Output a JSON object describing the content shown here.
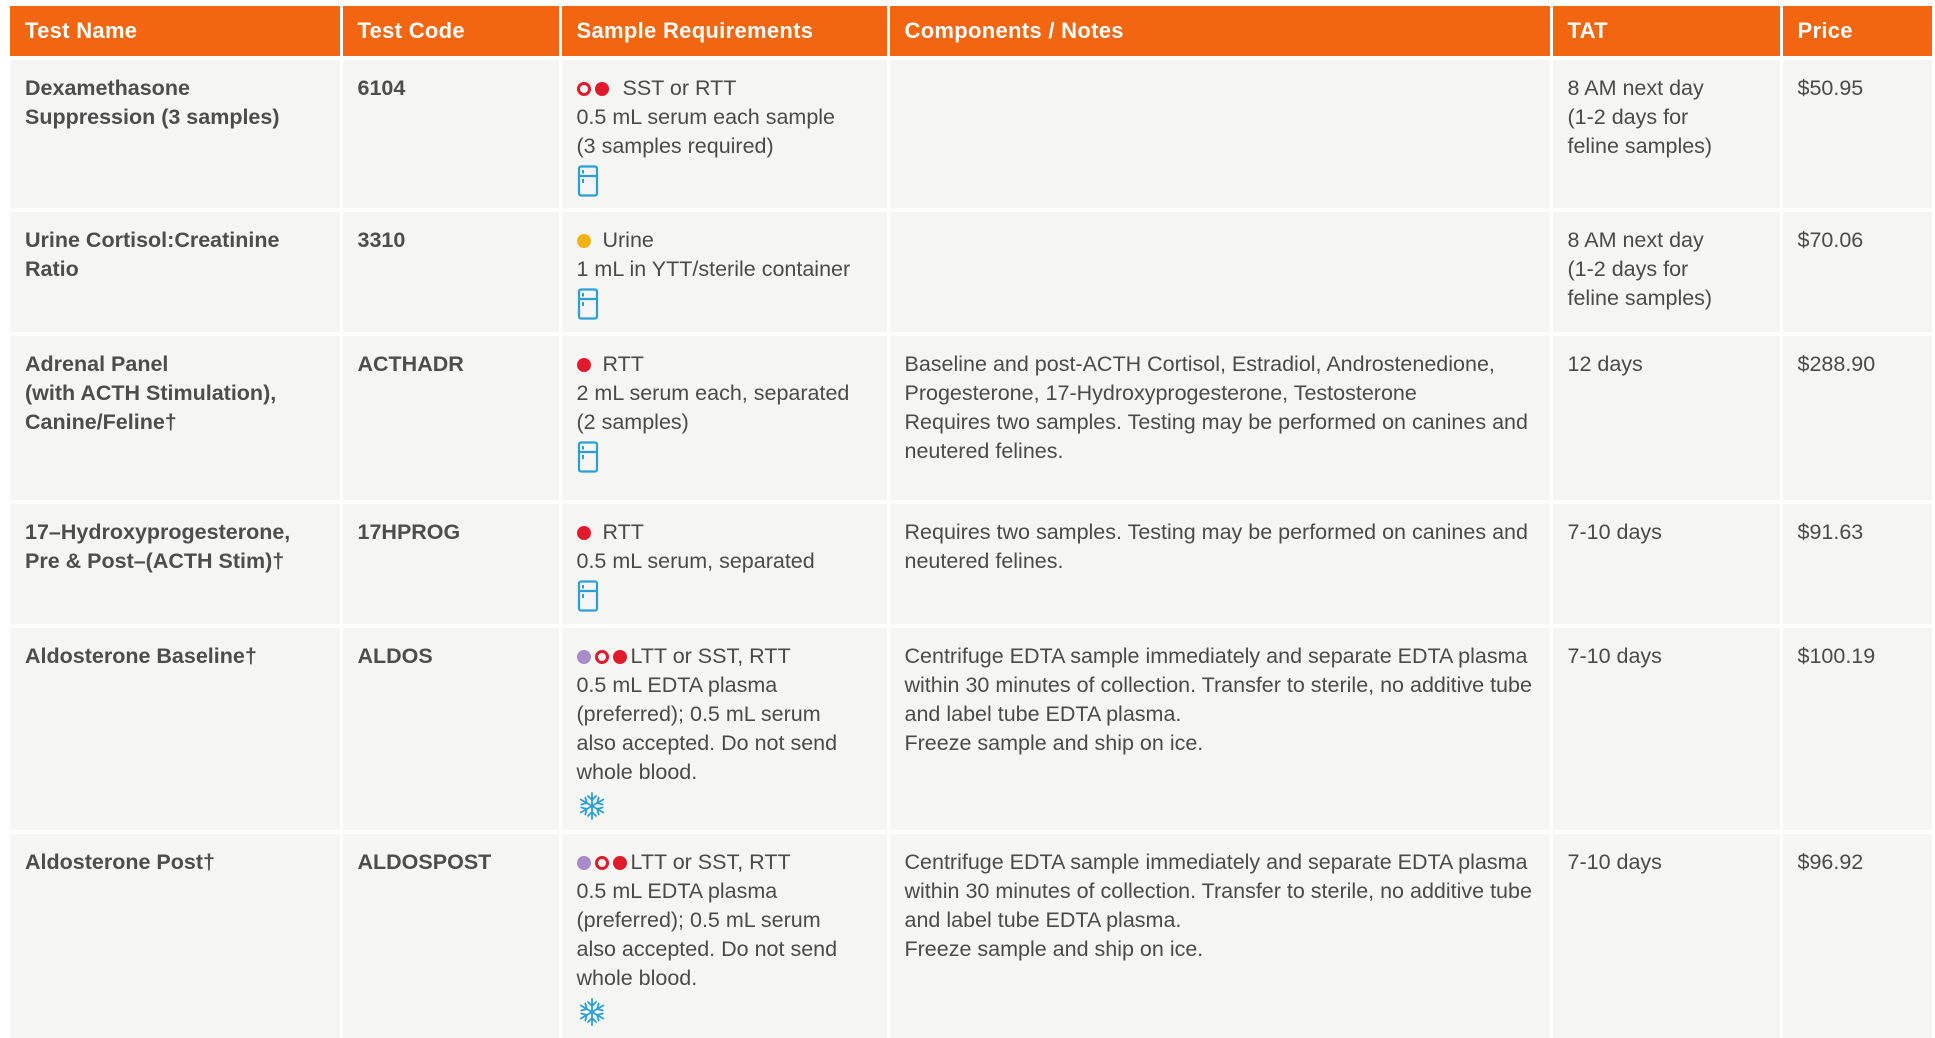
{
  "headers": {
    "test_name": "Test Name",
    "test_code": "Test Code",
    "sample_requirements": "Sample Requirements",
    "components_notes": "Components / Notes",
    "tat": "TAT",
    "price": "Price"
  },
  "colors": {
    "header_bg": "#f26511",
    "row_bg": "#f5f5f4",
    "red_dot": "#e11b2c",
    "yellow_dot": "#f4b315",
    "purple_dot": "#a88bc9",
    "icon_blue": "#2a9fd6"
  },
  "rows": [
    {
      "name_lines": [
        "Dexamethasone",
        "Suppression (3 samples)"
      ],
      "code": "6104",
      "tube_colors": [
        "red-ring",
        "red"
      ],
      "sample_lines": [
        "SST or RTT",
        "0.5 mL serum each sample",
        "(3 samples required)"
      ],
      "storage_icon": "refrigerator-icon",
      "notes": [],
      "tat_lines": [
        "8 AM next day",
        "(1-2 days for",
        "feline samples)"
      ],
      "price": "$50.95"
    },
    {
      "name_lines": [
        "Urine Cortisol:Creatinine",
        "Ratio"
      ],
      "code": "3310",
      "tube_colors": [
        "yellow"
      ],
      "sample_lines": [
        "Urine",
        "1 mL in YTT/sterile container"
      ],
      "storage_icon": "refrigerator-icon",
      "notes": [],
      "tat_lines": [
        "8 AM next day",
        "(1-2 days for",
        "feline samples)"
      ],
      "price": "$70.06"
    },
    {
      "name_lines": [
        "Adrenal Panel",
        "(with ACTH Stimulation),",
        "Canine/Feline†"
      ],
      "code": "ACTHADR",
      "tube_colors": [
        "red"
      ],
      "sample_lines": [
        "RTT",
        "2 mL serum each, separated",
        "(2 samples)"
      ],
      "storage_icon": "refrigerator-icon",
      "notes": [
        "Baseline and post-ACTH Cortisol, Estradiol, Androstenedione, Progesterone, 17-Hydroxyprogesterone, Testosterone",
        "Requires two samples. Testing may be performed on canines and neutered felines."
      ],
      "tat_lines": [
        "12 days"
      ],
      "price": "$288.90"
    },
    {
      "name_lines": [
        "17–Hydroxyprogesterone,",
        "Pre & Post–(ACTH Stim)†"
      ],
      "code": "17HPROG",
      "tube_colors": [
        "red"
      ],
      "sample_lines": [
        "RTT",
        "0.5 mL serum, separated"
      ],
      "storage_icon": "refrigerator-icon",
      "notes": [
        "Requires two samples. Testing may be performed on canines and neutered felines."
      ],
      "tat_lines": [
        "7-10 days"
      ],
      "price": "$91.63"
    },
    {
      "name_lines": [
        "Aldosterone Baseline†"
      ],
      "code": "ALDOS",
      "tube_colors": [
        "purple",
        "red-ring",
        "red"
      ],
      "sample_lines": [
        "LTT or SST, RTT",
        "0.5 mL EDTA plasma",
        "(preferred); 0.5 mL serum",
        "also accepted. Do not send",
        "whole blood."
      ],
      "storage_icon": "snowflake-icon",
      "notes": [
        "Centrifuge EDTA sample immediately and separate EDTA plasma within 30 minutes of collection. Transfer to sterile, no additive tube and label tube EDTA plasma.",
        "Freeze sample and ship on ice."
      ],
      "tat_lines": [
        "7-10 days"
      ],
      "price": "$100.19"
    },
    {
      "name_lines": [
        "Aldosterone Post†"
      ],
      "code": "ALDOSPOST",
      "tube_colors": [
        "purple",
        "red-ring",
        "red"
      ],
      "sample_lines": [
        "LTT or SST, RTT",
        "0.5 mL EDTA plasma",
        "(preferred); 0.5 mL serum",
        "also accepted. Do not send",
        "whole blood."
      ],
      "storage_icon": "snowflake-icon",
      "notes": [
        "Centrifuge EDTA sample immediately and separate EDTA plasma within 30 minutes of collection. Transfer to sterile, no additive tube and label tube EDTA plasma.",
        "Freeze sample and ship on ice."
      ],
      "tat_lines": [
        "7-10 days"
      ],
      "price": "$96.92"
    }
  ]
}
